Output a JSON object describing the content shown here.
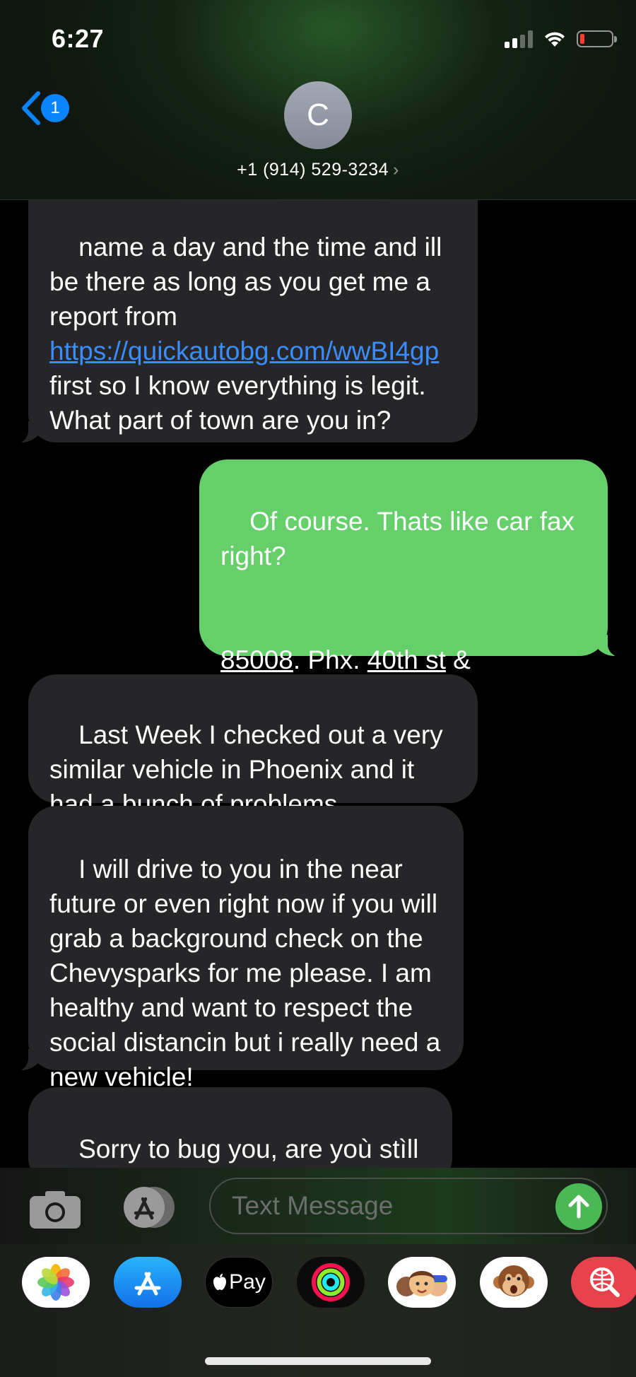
{
  "status_bar": {
    "time": "6:27"
  },
  "header": {
    "back_badge": "1",
    "avatar_initial": "C",
    "contact_number": "+1 (914) 529-3234",
    "contact_chevron": "›"
  },
  "messages": [
    {
      "direction": "incoming",
      "parts": [
        {
          "text": "name a day and the time and ill be there as long as you get me a report from "
        },
        {
          "text": "https://quickautobg.com/wwBI4gp",
          "link": true
        },
        {
          "text": " first so I know everything is legit. What part of town are you in?"
        }
      ]
    },
    {
      "direction": "outgoing",
      "line1": "Of course. Thats like car fax right?",
      "zip": "85008",
      "mid": ". Phx. ",
      "street": "40th st",
      "end": " & McDowell."
    },
    {
      "direction": "incoming",
      "text": "Last Week I checked out a very similar vehicle in Phoenix and it had a bunch of problems"
    },
    {
      "direction": "incoming",
      "text": "I will drive to you in the near future or even right now if you will grab a background check on the Chevysparks for me please. I am healthy and want to respect the social distancin but i really need a new vehicle!"
    },
    {
      "direction": "incoming",
      "text": "Sorry to bug you, are yoù stìll hère though?"
    }
  ],
  "input": {
    "placeholder": "Text Message"
  },
  "app_drawer": {
    "apps": [
      "photos-icon",
      "app-store-icon",
      "apple-pay-icon",
      "activity-icon",
      "memoji-icon",
      "animoji-monkey-icon",
      "web-search-icon"
    ],
    "apple_pay_label": "Pay"
  },
  "colors": {
    "incoming_bubble": "#262628",
    "outgoing_bubble": "#65d06a",
    "link": "#3a8dff",
    "ios_blue": "#0a84ff",
    "send_button": "#4cb855"
  }
}
